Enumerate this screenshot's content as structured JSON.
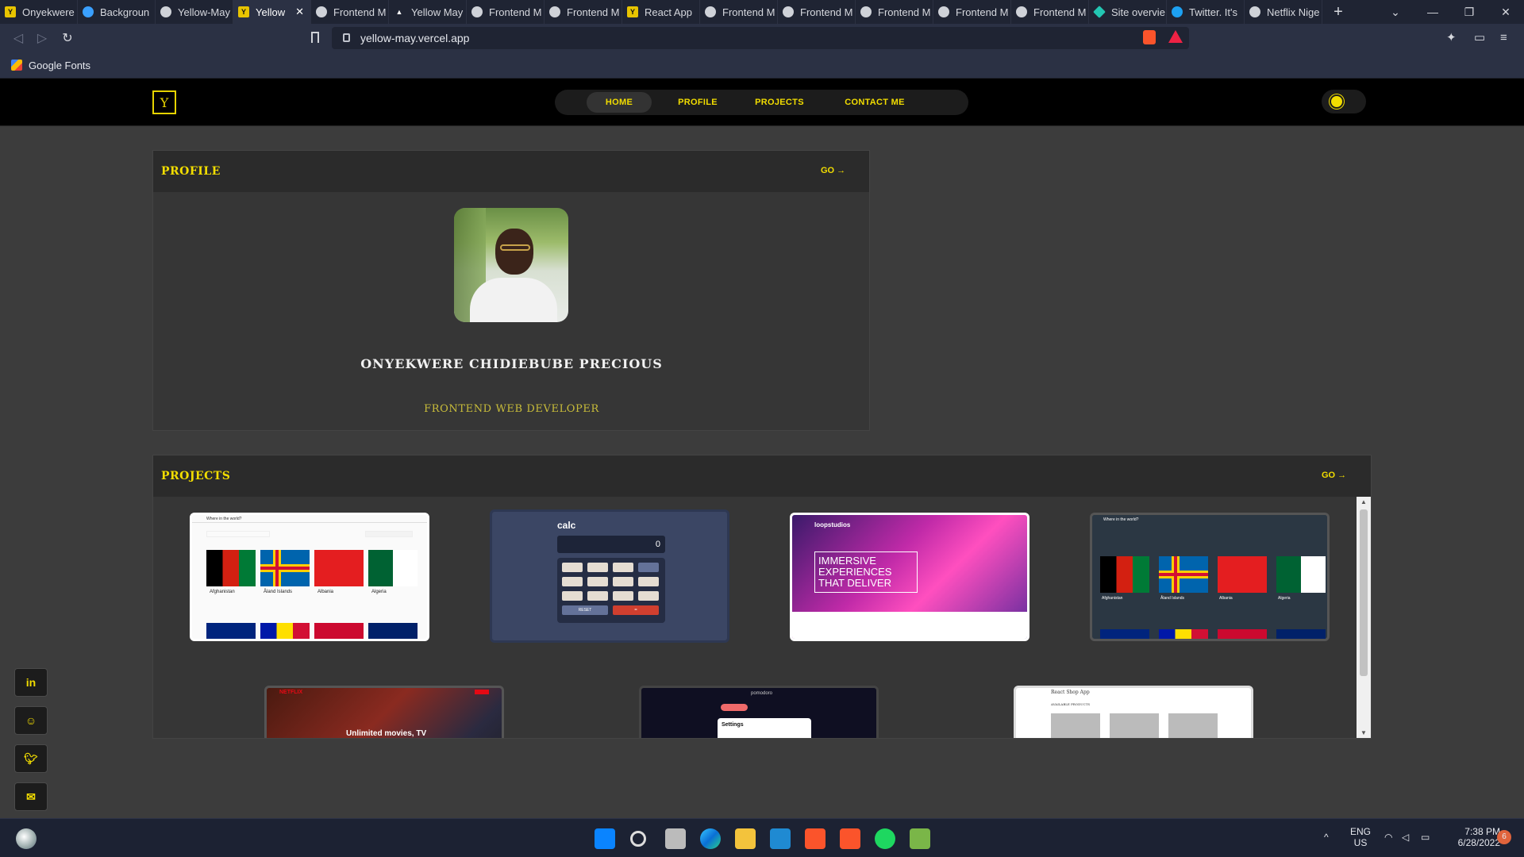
{
  "browser": {
    "tabs": [
      {
        "label": "Onyekwere"
      },
      {
        "label": "Backgroun"
      },
      {
        "label": "Yellow-May"
      },
      {
        "label": "Yellow"
      },
      {
        "label": "Frontend M"
      },
      {
        "label": "Yellow May"
      },
      {
        "label": "Frontend M"
      },
      {
        "label": "Frontend M"
      },
      {
        "label": "React App"
      },
      {
        "label": "Frontend M"
      },
      {
        "label": "Frontend M"
      },
      {
        "label": "Frontend M"
      },
      {
        "label": "Frontend M"
      },
      {
        "label": "Frontend M"
      },
      {
        "label": "Site overvie"
      },
      {
        "label": "Twitter. It's"
      },
      {
        "label": "Netflix Nige"
      }
    ],
    "url": "yellow-may.vercel.app",
    "bookmark": "Google Fonts"
  },
  "site": {
    "logo": "Y",
    "nav": [
      "HOME",
      "PROFILE",
      "PROJECTS",
      "CONTACT ME"
    ],
    "active_nav": "HOME",
    "accent": "#f2dd00"
  },
  "profile": {
    "title": "PROFILE",
    "go": "GO →",
    "name": "ONYEKWERE CHIDIEBUBE PRECIOUS",
    "role": "FRONTEND WEB DEVELOPER"
  },
  "projects": {
    "title": "PROJECTS",
    "go": "GO →",
    "items": [
      {
        "caption": "Where in the world?",
        "countries": [
          "Afghanistan",
          "Åland Islands",
          "Albania",
          "Algeria"
        ]
      },
      {
        "caption": "calc",
        "display": "0",
        "reset": "RESET",
        "equals": "="
      },
      {
        "caption": "loopstudios",
        "headline": "IMMERSIVE EXPERIENCES THAT DELIVER"
      },
      {
        "caption": "Where in the world?",
        "countries": [
          "Afghanistan",
          "Åland Islands",
          "Albania",
          "Algeria"
        ]
      },
      {
        "caption": "NETFLIX",
        "text": "Unlimited movies, TV"
      },
      {
        "caption": "pomodoro",
        "text": "Settings"
      },
      {
        "caption": "React Shop App",
        "text": "AVAILABLE PRODUCTS"
      }
    ]
  },
  "social": [
    "in",
    "github",
    "twitter",
    "mail"
  ],
  "taskbar": {
    "lang1": "ENG",
    "lang2": "US",
    "time": "7:38 PM",
    "date": "6/28/2022",
    "badge": "6"
  }
}
